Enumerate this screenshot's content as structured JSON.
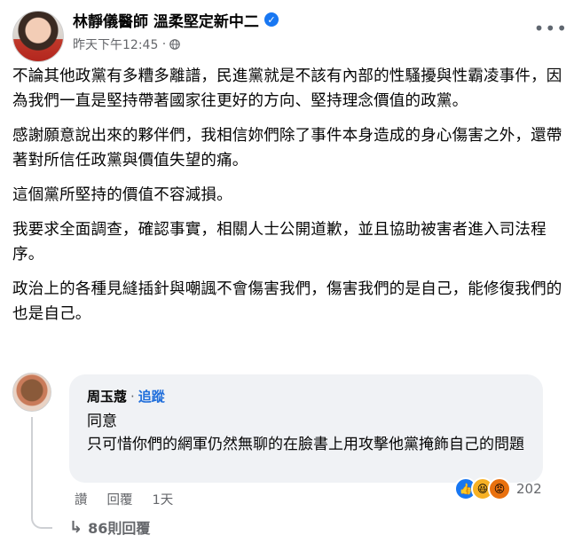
{
  "post": {
    "author": "林靜儀醫師 溫柔堅定新中二",
    "timestamp": "昨天下午12:45",
    "verified_icon": "verified-badge-icon",
    "privacy_icon": "globe-icon",
    "paragraphs": [
      "不論其他政黨有多糟多離譜，民進黨就是不該有內部的性騷擾與性霸凌事件，因為我們一直是堅持帶著國家往更好的方向、堅持理念價值的政黨。",
      "感謝願意說出來的夥伴們，我相信妳們除了事件本身造成的身心傷害之外，還帶著對所信任政黨與價值失望的痛。",
      "這個黨所堅持的價值不容減損。",
      "我要求全面調查，確認事實，相關人士公開道歉，並且協助被害者進入司法程序。",
      "政治上的各種見縫插針與嘲諷不會傷害我們，傷害我們的是自己，能修復我們的也是自己。"
    ]
  },
  "comment": {
    "author": "周玉蔻",
    "separator": "·",
    "follow_label": "追蹤",
    "lines": [
      "同意",
      "只可惜你們的網軍仍然無聊的在臉書上用攻擊他黨掩飾自己的問題"
    ],
    "actions": {
      "like": "讚",
      "reply": "回覆",
      "time": "1天"
    },
    "reaction_count": "202",
    "reactions": [
      "like",
      "haha",
      "angry"
    ],
    "replies_label": "86則回覆"
  },
  "colors": {
    "accent": "#1877f2",
    "follow": "#216fdb",
    "bubble": "#f0f2f5",
    "muted": "#65676b"
  }
}
